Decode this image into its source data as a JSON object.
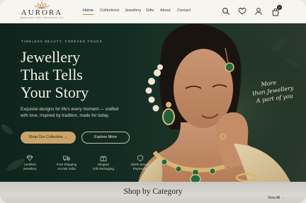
{
  "brand": {
    "name": "AURORA",
    "tagline": "JEWELLERY FOR A BRIGHTER YOU"
  },
  "nav": {
    "items": [
      {
        "label": "Home",
        "active": true
      },
      {
        "label": "Collections"
      },
      {
        "label": "Jewellery"
      },
      {
        "label": "Gifts"
      },
      {
        "label": "About"
      },
      {
        "label": "Contact"
      }
    ]
  },
  "header_icons": [
    "search-icon",
    "heart-icon",
    "user-icon",
    "bag-icon"
  ],
  "cart": {
    "count": "0"
  },
  "hero": {
    "eyebrow": "TIMELESS BEAUTY, FOREVER YOURS",
    "headline": [
      "Jewellery",
      "That Tells",
      "Your Story"
    ],
    "subtext": "Exquisite designs for life's every moment — crafted with love, inspired by tradition, made for today.",
    "primary_cta": "Shop Our Collection →",
    "secondary_cta": "Explore More",
    "script": [
      "More",
      "than Jewellery",
      "A part of you"
    ],
    "features": [
      {
        "icon": "diamond-icon",
        "line1": "Certified",
        "line2": "Jewellery"
      },
      {
        "icon": "truck-icon",
        "line1": "Free Shipping",
        "line2": "Across India"
      },
      {
        "icon": "gift-icon",
        "line1": "Elegant",
        "line2": "Gift Packaging"
      },
      {
        "icon": "shield-icon",
        "line1": "100% Secure",
        "line2": "Payments"
      }
    ]
  },
  "categories": {
    "title": "Shop by Category",
    "view_all": "View All →"
  },
  "colors": {
    "hero_green": "#132c23",
    "gold": "#c9a46a",
    "header_bg": "#f7f5f0"
  }
}
